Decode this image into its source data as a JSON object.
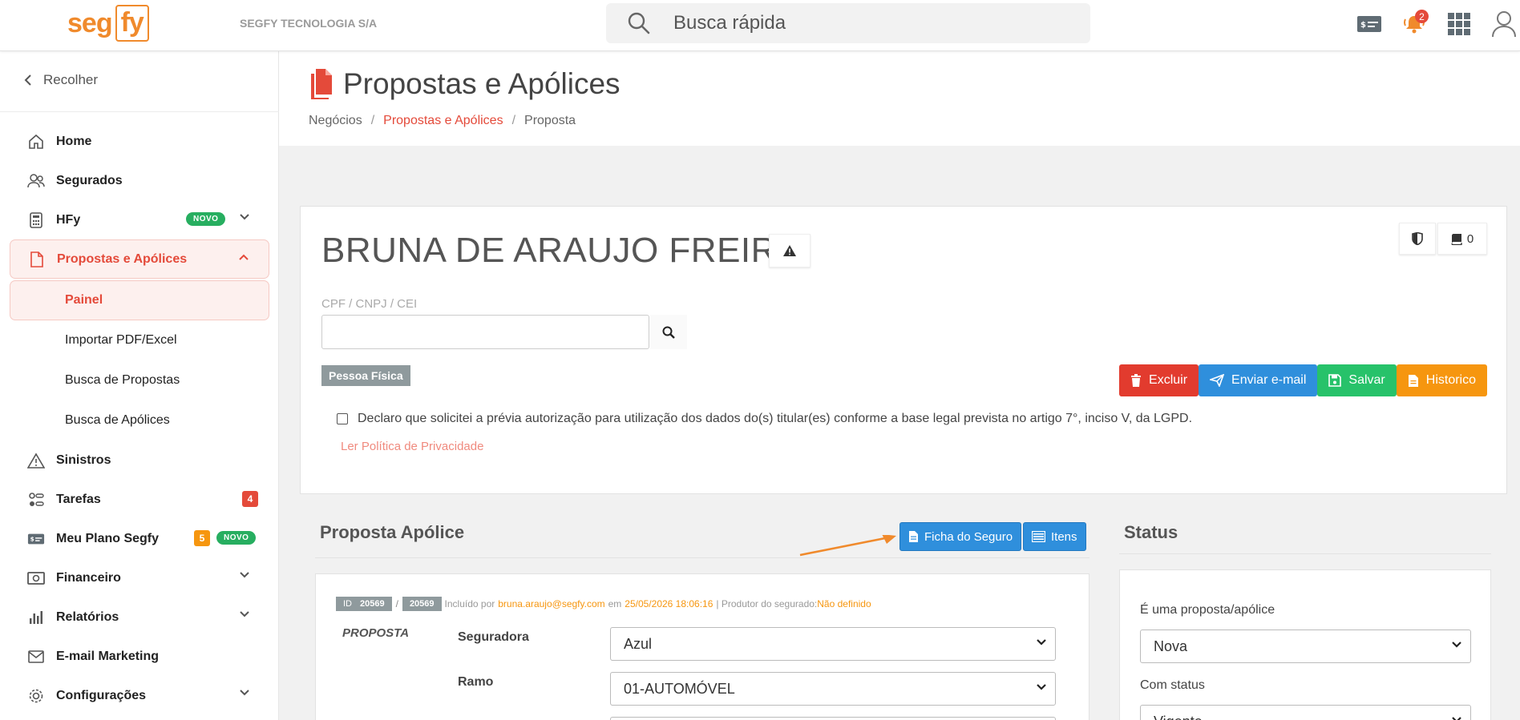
{
  "header": {
    "logo_seg": "seg",
    "logo_fy": "fy",
    "company": "SEGFY TECNOLOGIA S/A",
    "search_placeholder": "Busca rápida",
    "notifications_count": "2"
  },
  "sidebar": {
    "collapse_label": "Recolher",
    "items": [
      {
        "label": "Home"
      },
      {
        "label": "Segurados"
      },
      {
        "label": "HFy",
        "badge": "NOVO"
      },
      {
        "label": "Propostas e Apólices"
      },
      {
        "label": "Sinistros"
      },
      {
        "label": "Tarefas",
        "badge": "4"
      },
      {
        "label": "Meu Plano Segfy",
        "badge": "5",
        "badge2": "NOVO"
      },
      {
        "label": "Financeiro"
      },
      {
        "label": "Relatórios"
      },
      {
        "label": "E-mail Marketing"
      },
      {
        "label": "Configurações"
      }
    ],
    "subitems": [
      {
        "label": "Painel"
      },
      {
        "label": "Importar PDF/Excel"
      },
      {
        "label": "Busca de Propostas"
      },
      {
        "label": "Busca de Apólices"
      }
    ]
  },
  "page": {
    "title": "Propostas e Apólices",
    "breadcrumb": [
      "Negócios",
      "Propostas e Apólices",
      "Proposta"
    ]
  },
  "client": {
    "name": "BRUNA DE ARAUJO FREIRE",
    "book_count": "0",
    "cpf_label": "CPF / CNPJ / CEI",
    "cpf_value": "",
    "person_type": "Pessoa Física",
    "actions": [
      "Excluir",
      "Enviar e-mail",
      "Salvar",
      "Historico"
    ],
    "lgpd_text": "Declaro que solicitei a prévia autorização para utilização dos dados do(s) titular(es) conforme a base legal prevista no artigo 7°, inciso V, da LGPD.",
    "privacy_link": "Ler Política de Privacidade"
  },
  "proposal": {
    "section_title": "Proposta Apólice",
    "ficha_button": "Ficha do Seguro",
    "itens_button": "Itens",
    "id_label": "ID",
    "id_value": "20569",
    "id_value2": "20569",
    "included_by": "Incluído por",
    "user_email": "bruna.araujo@segfy.com",
    "on_text": "em",
    "date": "25/05/2026 18:06:16",
    "producer_text": "| Produtor do segurado:",
    "producer_value": "Não definido",
    "type_label": "PROPOSTA",
    "seguradora_label": "Seguradora",
    "seguradora_value": "Azul",
    "ramo_label": "Ramo",
    "ramo_value": "01-AUTOMÓVEL"
  },
  "status": {
    "section_title": "Status",
    "type_label": "É uma proposta/apólice",
    "type_value": "Nova",
    "status_label": "Com status",
    "status_value": "Vigente"
  }
}
